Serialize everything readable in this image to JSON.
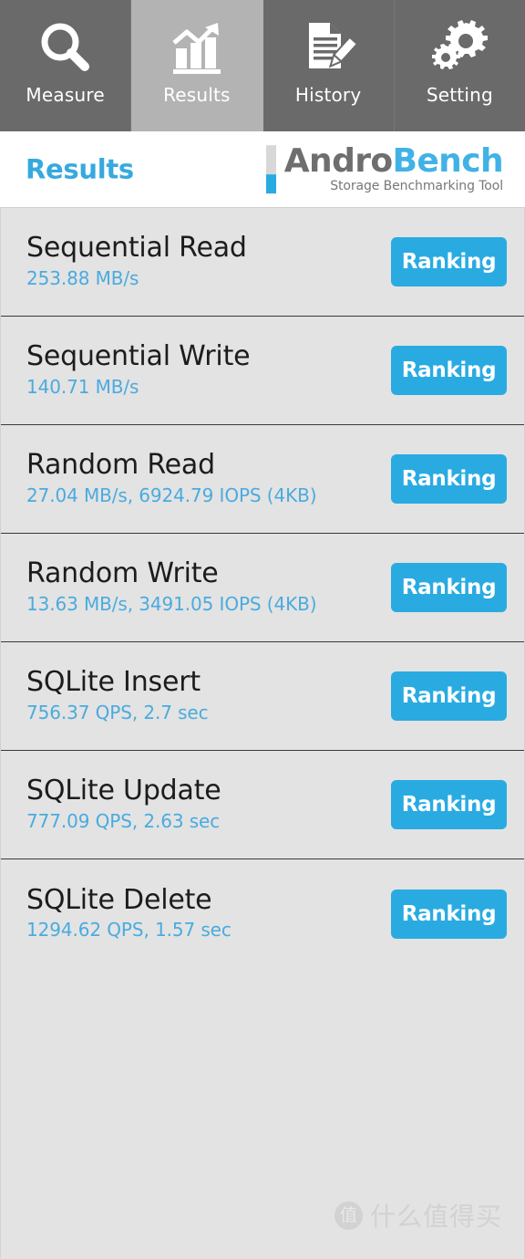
{
  "tabs": [
    {
      "label": "Measure",
      "icon": "magnifier-icon",
      "active": false
    },
    {
      "label": "Results",
      "icon": "bar-chart-trend-icon",
      "active": true
    },
    {
      "label": "History",
      "icon": "document-pencil-icon",
      "active": false
    },
    {
      "label": "Setting",
      "icon": "gears-icon",
      "active": false
    }
  ],
  "header": {
    "title": "Results",
    "logo": {
      "word_primary": "Andro",
      "word_secondary": "Bench",
      "tagline": "Storage Benchmarking Tool"
    }
  },
  "results": {
    "ranking_label": "Ranking",
    "rows": [
      {
        "name": "Sequential Read",
        "value": "253.88 MB/s"
      },
      {
        "name": "Sequential Write",
        "value": "140.71 MB/s"
      },
      {
        "name": "Random Read",
        "value": "27.04 MB/s, 6924.79 IOPS (4KB)"
      },
      {
        "name": "Random Write",
        "value": "13.63 MB/s, 3491.05 IOPS (4KB)"
      },
      {
        "name": "SQLite Insert",
        "value": "756.37 QPS, 2.7 sec"
      },
      {
        "name": "SQLite Update",
        "value": "777.09 QPS, 2.63 sec"
      },
      {
        "name": "SQLite Delete",
        "value": "1294.62 QPS, 1.57 sec"
      }
    ]
  },
  "watermark": {
    "badge": "值",
    "text": "什么值得买"
  },
  "colors": {
    "accent_blue": "#29abe2",
    "value_blue": "#4aabdf",
    "title_blue": "#36a9de",
    "tabbar_bg": "#6a6a6a",
    "tab_active_bg": "#b3b3b3",
    "list_bg": "#e3e3e3",
    "row_divider": "#3a3a3a",
    "logo_gray": "#6e6e6e"
  }
}
